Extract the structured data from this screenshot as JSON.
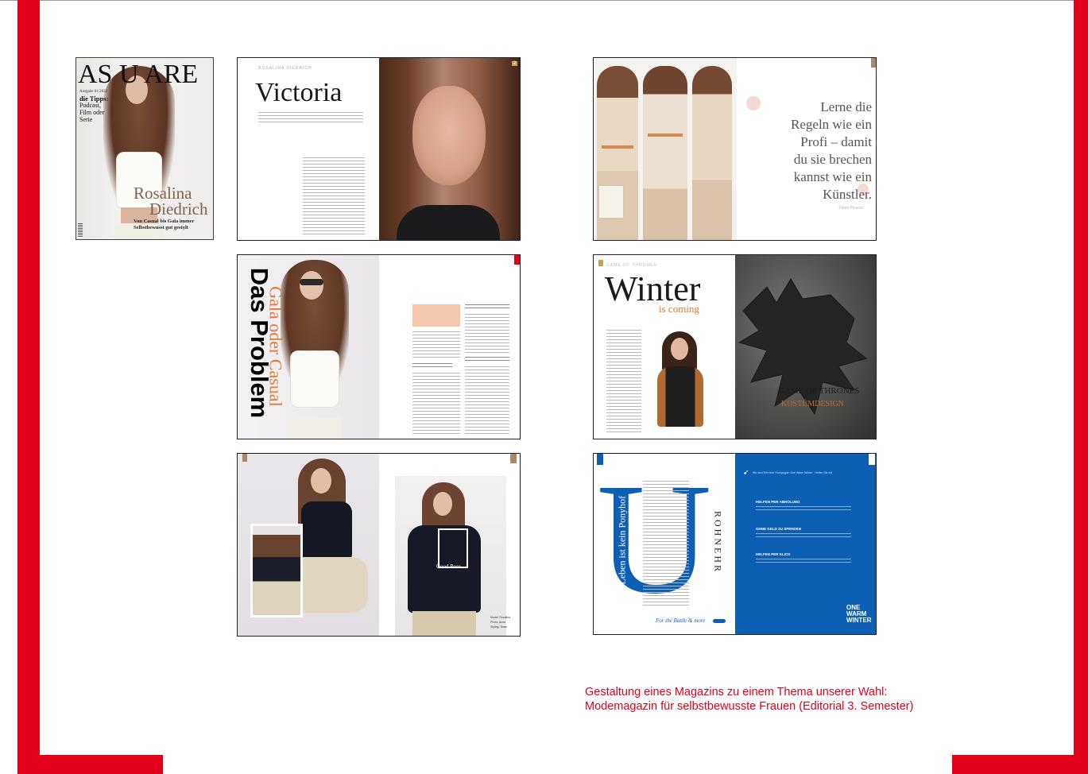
{
  "colors": {
    "accent": "#e2001a",
    "blue": "#0d5fb3",
    "orange": "#e07a35"
  },
  "cover": {
    "title": "AS U ARE",
    "issue": "Ausgabe 01/2022",
    "tips_heading": "die Tipps:",
    "tips_lines": [
      "Podcast,",
      "Film oder",
      "Serie"
    ],
    "name_line1": "Rosalina",
    "name_line2": "Diedrich",
    "subline1": "Von Casual bis Gala immer",
    "subline2": "Selbstbewusst gut gestylt"
  },
  "spread_victoria": {
    "title": "Victoria",
    "kicker": "ROSALINA DIEDRICH",
    "page_number": "2"
  },
  "spread_quote": {
    "quote_lines": [
      "Lerne die",
      "Regeln wie ein",
      "Profi – damit",
      "du sie brechen",
      "kannst wie ein",
      "Künstler."
    ],
    "attribution": "Pablo Picasso"
  },
  "spread_casual": {
    "title_vertical": "Das Problem",
    "accent_vertical": "Gala oder Casual"
  },
  "spread_winter": {
    "title": "Winter",
    "subtitle": "is coming",
    "kicker": "GAME OF THRONES",
    "sigil_text1": "GAME OF THRONES",
    "sigil_text2": "KOSTÜMDESIGN"
  },
  "spread_photo": {
    "overlay_text": "Good Pose",
    "credit_lines": [
      "Model: Rosalina",
      "Photo: Anna",
      "Styling: Team"
    ]
  },
  "spread_one_warm": {
    "big_letter": "U",
    "vertical_left": "Das Leben ist kein Ponyhof",
    "vertical_right": "ROHNEHR",
    "signature": "For the Battle & more",
    "top_line": "Wir sind Teil einer Kampagne: One Warm Winter · Helfen Sie mit",
    "headings": [
      "HELFEN PER ABHOLUNG",
      "OHNE GELD ZU SPENDEN",
      "HELFEN PER KLICK"
    ],
    "brand": [
      "ONE",
      "WARM",
      "WINTER"
    ]
  },
  "caption": {
    "line1": "Gestaltung eines Magazins zu einem Thema unserer Wahl:",
    "line2": "Modemagazin für selbstbewusste Frauen (Editorial 3. Semester)"
  }
}
